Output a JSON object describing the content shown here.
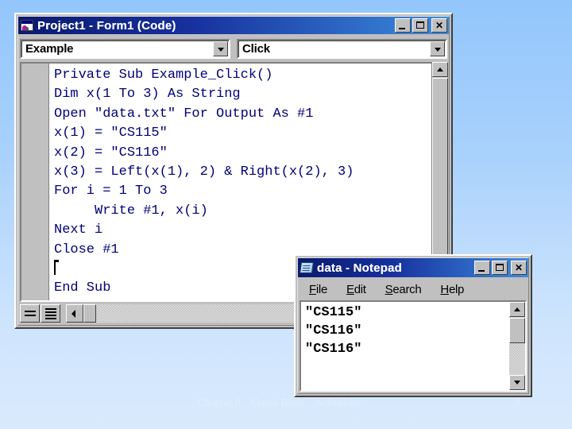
{
  "slide": {
    "background_top_color": "#93c6fc",
    "background_bottom_color": "#d9eafd"
  },
  "vb_window": {
    "title": "Project1 - Form1 (Code)",
    "app_icon": "visual-basic-icon",
    "titlebar_color_left": "#0a1a6e",
    "titlebar_color_right": "#3f8ade",
    "buttons": {
      "minimize": "_",
      "maximize": "□",
      "close": "✕"
    },
    "object_combo": {
      "value": "Example",
      "arrow": "▼"
    },
    "procedure_combo": {
      "value": "Click",
      "arrow": "▼"
    },
    "code_color": "#00007a",
    "code_lines": [
      "Private Sub Example_Click()",
      "Dim x(1 To 3) As String",
      "Open \"data.txt\" For Output As #1",
      "x(1) = \"CS115\"",
      "x(2) = \"CS116\"",
      "x(3) = Left(x(1), 2) & Right(x(2), 3)",
      "For i = 1 To 3",
      "     Write #1, x(i)",
      "Next i",
      "Close #1",
      "",
      "End Sub"
    ],
    "caret_line_index": 10,
    "bottom_buttons": {
      "procedure_view": "procedure-view-button",
      "full_module_view": "full-module-view-button"
    }
  },
  "notepad_window": {
    "title": "data - Notepad",
    "app_icon": "notepad-icon",
    "buttons": {
      "minimize": "_",
      "maximize": "□",
      "close": "✕"
    },
    "menu": [
      {
        "label": "File",
        "accel": "F",
        "rest": "ile"
      },
      {
        "label": "Edit",
        "accel": "E",
        "rest": "dit"
      },
      {
        "label": "Search",
        "accel": "S",
        "rest": "earch"
      },
      {
        "label": "Help",
        "accel": "H",
        "rest": "elp"
      }
    ],
    "content_lines": [
      "\"CS115\"",
      "\"CS116\"",
      "\"CS116\""
    ]
  },
  "footer": {
    "text": "Chapter 8 - Visual Basic    Schneider",
    "page_number": "9"
  }
}
